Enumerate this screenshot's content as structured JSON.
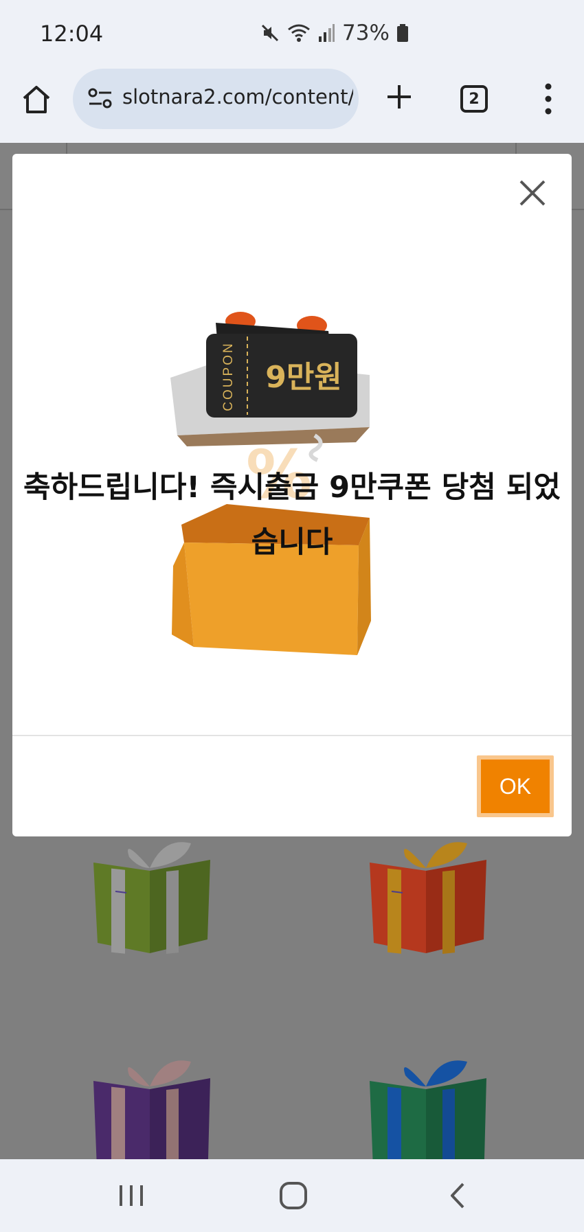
{
  "status_bar": {
    "time": "12:04",
    "battery_percent": "73%",
    "icons": [
      "mute-icon",
      "wifi-icon",
      "signal-icon",
      "battery-icon"
    ]
  },
  "browser": {
    "url": "slotnara2.com/content/",
    "tab_count": "2",
    "icons": [
      "home-icon",
      "site-settings-icon",
      "new-tab-plus-icon",
      "tabs-icon",
      "more-menu-icon"
    ]
  },
  "modal": {
    "message": "축하드립니다! 즉시출금 9만쿠폰 당첨 되었습니다",
    "ok_label": "OK",
    "promo": {
      "coupon_label": "COUPON",
      "coupon_value": "9만원"
    }
  },
  "background_page": {
    "gift_colors": [
      "#5f7a26",
      "#b5381e",
      "#4a2a6a",
      "#1e6b44"
    ],
    "ribbon_colors": [
      "#999999",
      "#b8851c",
      "#a08080",
      "#1552a3"
    ]
  },
  "navbar": {
    "icons": [
      "recent-apps-icon",
      "home-nav-icon",
      "back-icon"
    ]
  },
  "colors": {
    "accent": "#f08200",
    "accent_border": "#f9c68c",
    "chrome_bg": "#eef1f7",
    "url_bg": "#d9e2ef",
    "overlay": "#7f7f7f"
  }
}
